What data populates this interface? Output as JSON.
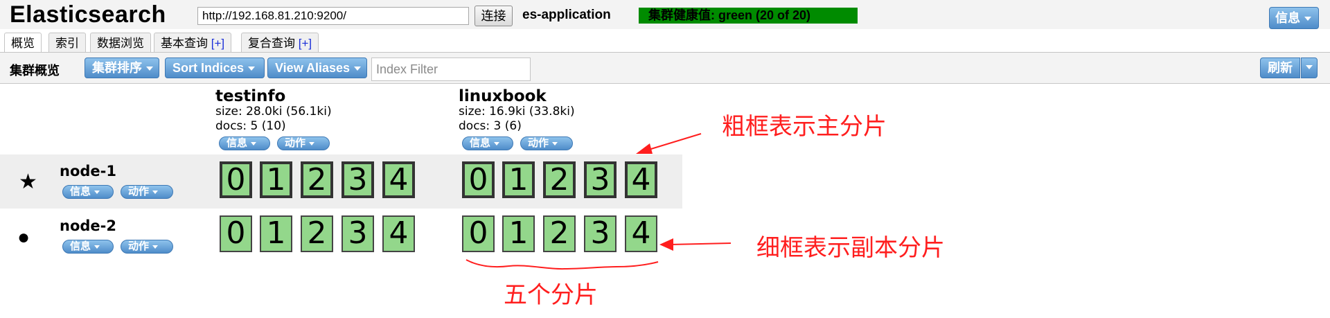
{
  "header": {
    "app_title": "Elasticsearch",
    "url_value": "http://192.168.81.210:9200/",
    "connect_label": "连接",
    "cluster_name": "es-application",
    "health_text": "集群健康值: green (20 of 20)",
    "info_label": "信息",
    "health_color": "#008b00"
  },
  "tabs": [
    {
      "label": "概览",
      "plus": ""
    },
    {
      "label": "索引",
      "plus": ""
    },
    {
      "label": "数据浏览",
      "plus": ""
    },
    {
      "label": "基本查询",
      "plus": "[+]"
    },
    {
      "label": "复合查询",
      "plus": "[+]"
    }
  ],
  "toolbar": {
    "page_heading": "集群概览",
    "sort_cluster_label": "集群排序",
    "sort_indices_label": "Sort Indices",
    "view_aliases_label": "View Aliases",
    "index_filter_placeholder": "Index Filter",
    "refresh_label": "刷新"
  },
  "indices": [
    {
      "name": "testinfo",
      "size": "size: 28.0ki (56.1ki)",
      "docs": "docs: 5 (10)",
      "info_label": "信息",
      "action_label": "动作"
    },
    {
      "name": "linuxbook",
      "size": "size: 16.9ki (33.8ki)",
      "docs": "docs: 3 (6)",
      "info_label": "信息",
      "action_label": "动作"
    }
  ],
  "nodes": [
    {
      "name": "node-1",
      "icon": "star-icon",
      "glyph": "★",
      "info_label": "信息",
      "action_label": "动作",
      "shard_type": "primary",
      "shards": [
        [
          "0",
          "1",
          "2",
          "3",
          "4"
        ],
        [
          "0",
          "1",
          "2",
          "3",
          "4"
        ]
      ]
    },
    {
      "name": "node-2",
      "icon": "circle-icon",
      "glyph": "●",
      "info_label": "信息",
      "action_label": "动作",
      "shard_type": "replica",
      "shards": [
        [
          "0",
          "1",
          "2",
          "3",
          "4"
        ],
        [
          "0",
          "1",
          "2",
          "3",
          "4"
        ]
      ]
    }
  ],
  "shard_color": "#93d78b",
  "annotations": {
    "primary_note": "粗框表示主分片",
    "replica_note": "细框表示副本分片",
    "five_shards_note": "五个分片",
    "color": "#ff1e1e"
  }
}
